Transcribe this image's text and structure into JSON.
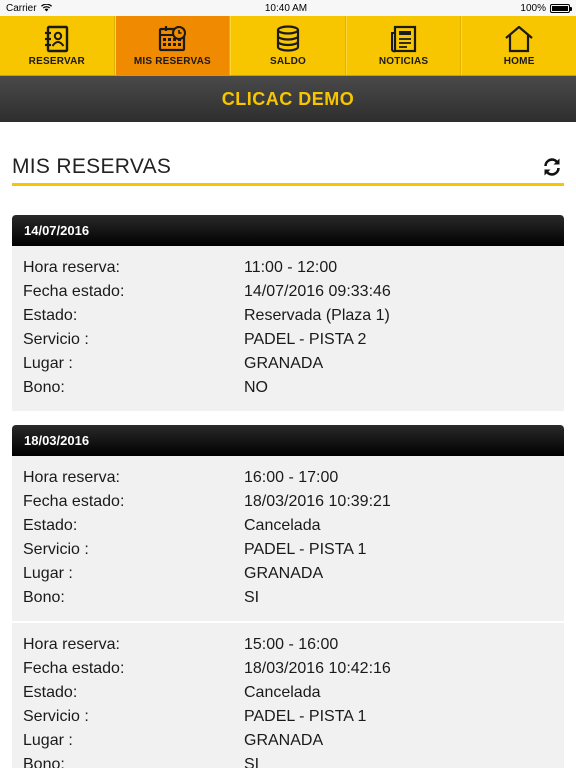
{
  "status": {
    "carrier": "Carrier",
    "time": "10:40 AM",
    "battery": "100%"
  },
  "nav": [
    {
      "label": "RESERVAR",
      "icon": "address-book-icon",
      "active": false
    },
    {
      "label": "MIS RESERVAS",
      "icon": "calendar-icon",
      "active": true
    },
    {
      "label": "SALDO",
      "icon": "coins-icon",
      "active": false
    },
    {
      "label": "NOTICIAS",
      "icon": "newspaper-icon",
      "active": false
    },
    {
      "label": "HOME",
      "icon": "home-icon",
      "active": false
    }
  ],
  "brand": "CLICAC DEMO",
  "section": {
    "title": "MIS RESERVAS"
  },
  "labels": {
    "hora": "Hora reserva:",
    "fecha": "Fecha estado:",
    "estado": "Estado:",
    "servicio": "Servicio :",
    "lugar": "Lugar :",
    "bono": "Bono:"
  },
  "cards": [
    {
      "date": "14/07/2016",
      "entries": [
        {
          "hora": "11:00 - 12:00",
          "fecha": "14/07/2016 09:33:46",
          "estado": "Reservada (Plaza 1)",
          "servicio": "PADEL - PISTA 2",
          "lugar": "GRANADA",
          "bono": "NO"
        }
      ]
    },
    {
      "date": "18/03/2016",
      "entries": [
        {
          "hora": "16:00 - 17:00",
          "fecha": "18/03/2016 10:39:21",
          "estado": "Cancelada",
          "servicio": "PADEL - PISTA 1",
          "lugar": "GRANADA",
          "bono": "SI"
        },
        {
          "hora": "15:00 - 16:00",
          "fecha": "18/03/2016 10:42:16",
          "estado": "Cancelada",
          "servicio": "PADEL - PISTA 1",
          "lugar": "GRANADA",
          "bono": "SI"
        }
      ]
    }
  ]
}
